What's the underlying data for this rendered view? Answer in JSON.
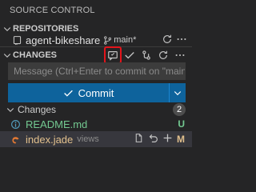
{
  "header": {
    "title": "SOURCE CONTROL"
  },
  "repositories": {
    "section_label": "REPOSITORIES",
    "repo_name": "agent-bikeshare",
    "branch": "main*"
  },
  "changes_section": {
    "label": "CHANGES",
    "message_placeholder": "Message (Ctrl+Enter to commit on \"main\")",
    "commit_label": "Commit",
    "group_label": "Changes",
    "group_count": "2",
    "files": [
      {
        "name": "README.md",
        "dir": "",
        "status": "U",
        "color": "#73c991"
      },
      {
        "name": "index.jade",
        "dir": "views",
        "status": "M",
        "color": "#e2c08d"
      }
    ]
  },
  "colors": {
    "accent": "#0e639c",
    "highlight": "#e3141b",
    "untracked": "#73c991",
    "modified": "#e2c08d"
  },
  "icons": [
    "chevron-down-icon",
    "repo-icon",
    "branch-icon",
    "commit-icon",
    "check-icon",
    "refresh-icon",
    "more-icon",
    "open-file-icon",
    "discard-icon",
    "stage-icon",
    "markdown-icon",
    "jade-file-icon"
  ]
}
